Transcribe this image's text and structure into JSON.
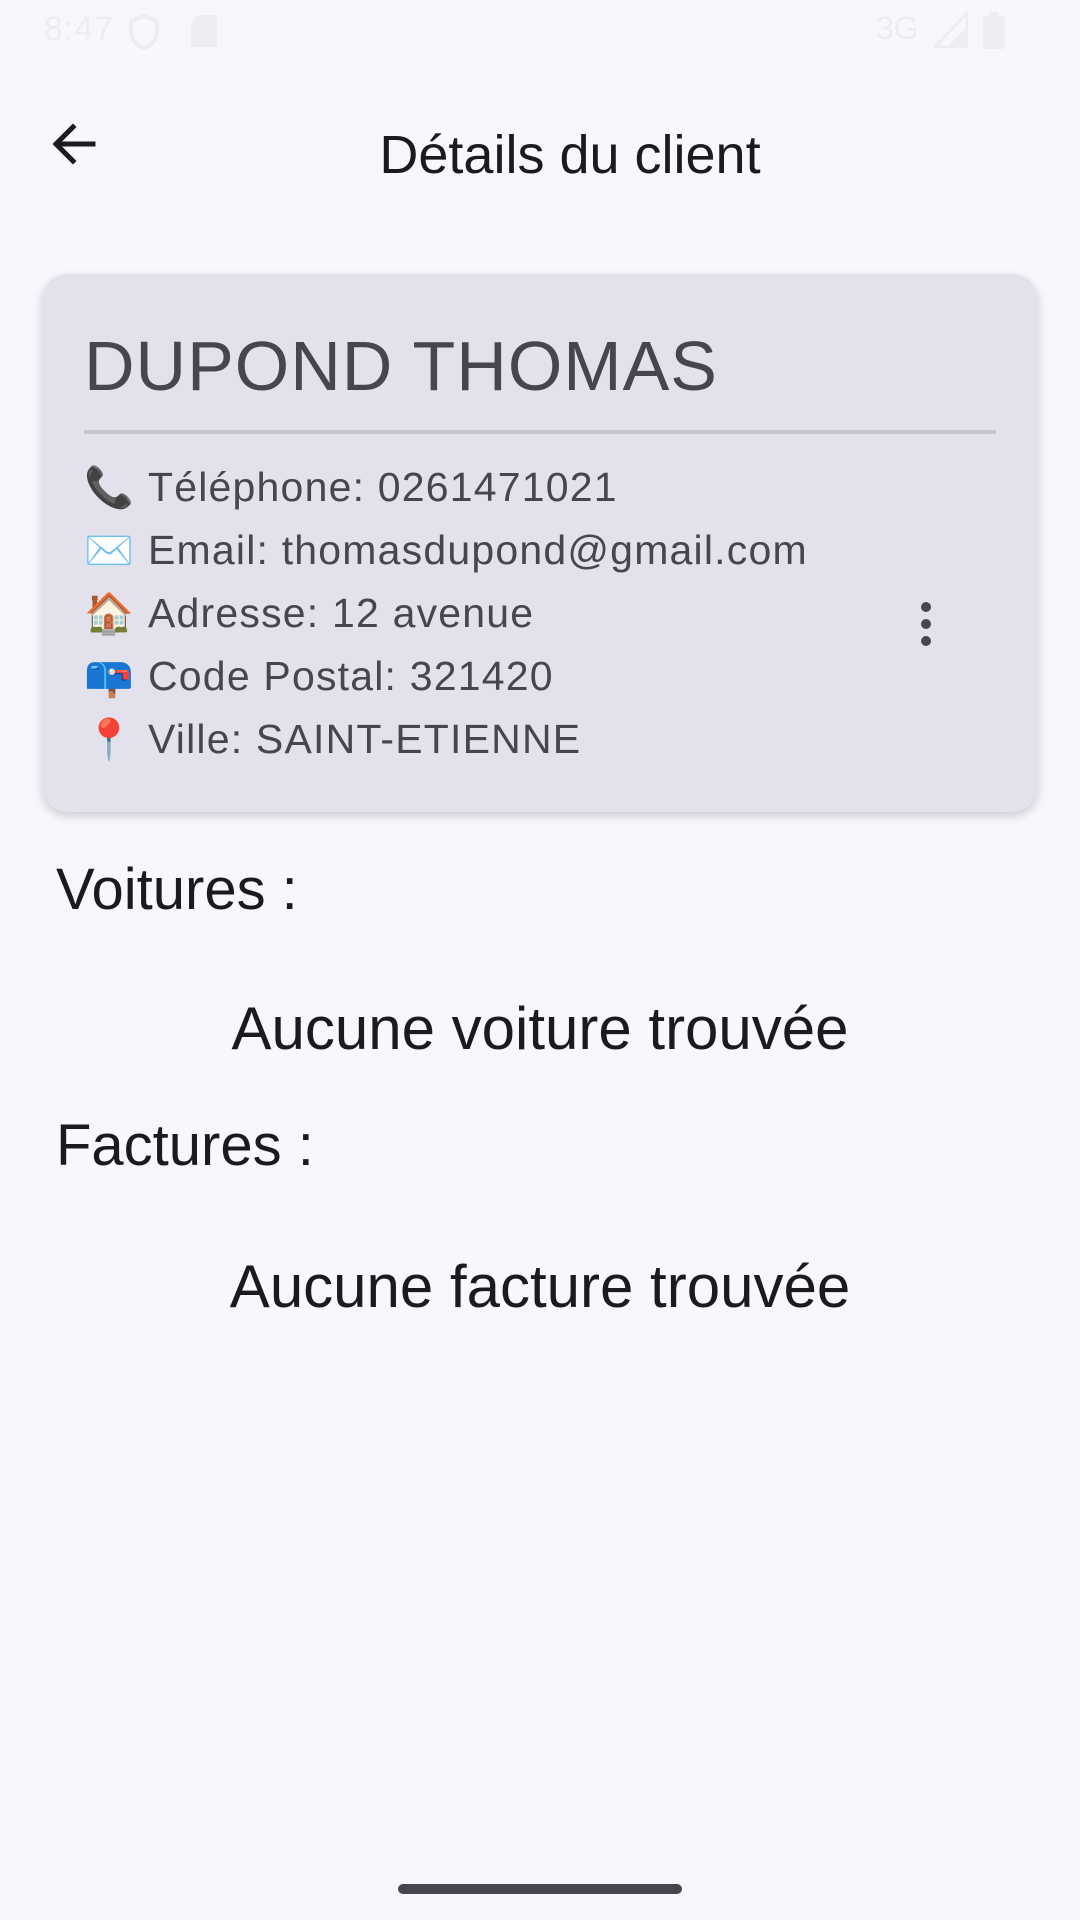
{
  "status_bar": {
    "time": "8:47",
    "network": "3G",
    "icons": [
      "shield-icon",
      "sd-card-icon",
      "signal-icon",
      "battery-icon"
    ]
  },
  "app_bar": {
    "title": "Détails du client",
    "back_icon": "arrow-back-icon"
  },
  "client": {
    "name": "DUPOND THOMAS",
    "details": [
      {
        "emoji": "📞",
        "text": "Téléphone: 0261471021"
      },
      {
        "emoji": "✉️",
        "text": "Email: thomasdupond@gmail.com"
      },
      {
        "emoji": "🏠",
        "text": "Adresse: 12 avenue"
      },
      {
        "emoji": "📪",
        "text": "Code Postal: 321420"
      },
      {
        "emoji": "📍",
        "text": "Ville: SAINT-ETIENNE"
      }
    ],
    "menu_icon": "more-vertical-icon"
  },
  "sections": {
    "cars": {
      "title": "Voitures :",
      "empty_text": "Aucune voiture trouvée"
    },
    "invoices": {
      "title": "Factures :",
      "empty_text": "Aucune facture trouvée"
    }
  },
  "colors": {
    "background": "#f8f7fd",
    "card": "#e3e2ec",
    "text_primary": "#1b1b1f",
    "text_secondary": "#45464f"
  }
}
